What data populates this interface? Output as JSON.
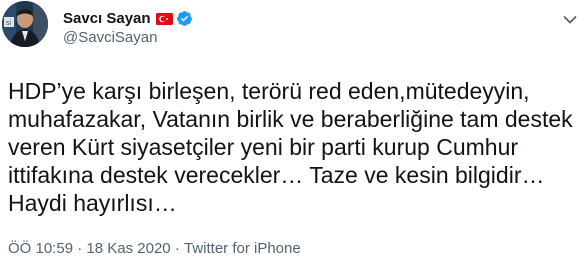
{
  "author": {
    "display_name": "Savcı Sayan",
    "handle": "@SavciSayan",
    "verified": true,
    "flag": "turkey-flag",
    "avatar_icon": "profile-photo"
  },
  "tweet": {
    "text": "HDP’ye karşı birleşen, terörü red eden,mütedeyyin,\nmuhafazakar, Vatanın birlik ve beraberliğine tam destek\nveren Kürt siyasetçiler yeni bir parti kurup Cumhur\nittifakına destek verecekler… Taze ve kesin bilgidir…\nHaydi hayırlısı…"
  },
  "meta": {
    "time": "ÖÖ 10:59",
    "separator": "·",
    "date": "18 Kas 2020",
    "source": "Twitter for iPhone"
  },
  "colors": {
    "text": "#0f1419",
    "secondary": "#536471",
    "verified": "#1d9bf0",
    "flag_red": "#e30a17"
  }
}
